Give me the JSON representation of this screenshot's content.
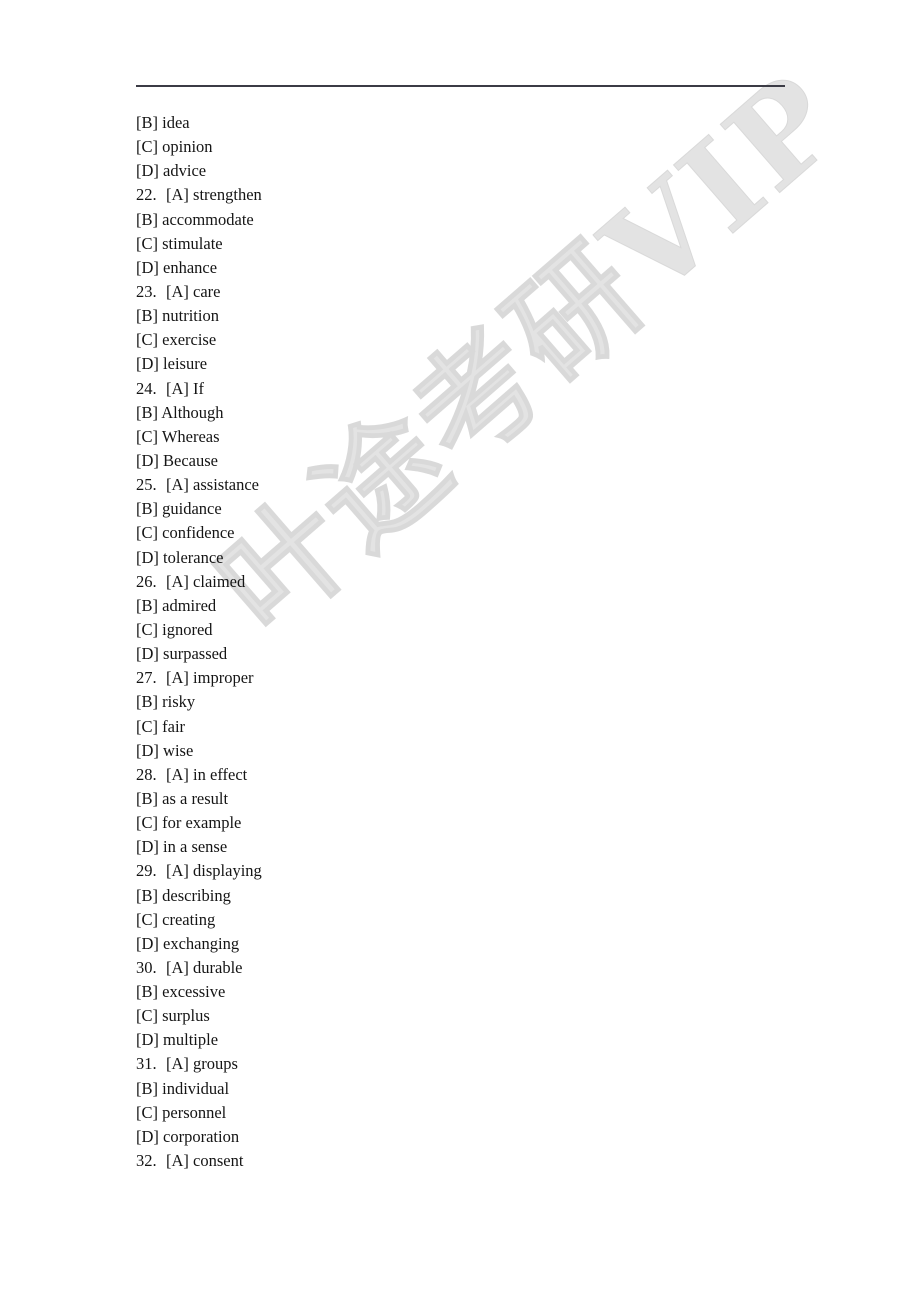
{
  "page": {
    "background_color": "#ffffff",
    "text_color": "#151515",
    "rule_color": "#3b3b45"
  },
  "watermark": {
    "text": "叶途考研VIP",
    "color": "#e2e2e2",
    "rotation_deg": -41
  },
  "header": {
    "rule": "horizontal-rule"
  },
  "lines": [
    {
      "num": "",
      "text": "[B] idea"
    },
    {
      "num": "",
      "text": "[C] opinion"
    },
    {
      "num": "",
      "text": "[D] advice"
    },
    {
      "num": "22.",
      "text": "[A] strengthen"
    },
    {
      "num": "",
      "text": "[B] accommodate"
    },
    {
      "num": "",
      "text": "[C] stimulate"
    },
    {
      "num": "",
      "text": "[D] enhance"
    },
    {
      "num": "23.",
      "text": "[A] care"
    },
    {
      "num": "",
      "text": "[B] nutrition"
    },
    {
      "num": "",
      "text": "[C] exercise"
    },
    {
      "num": "",
      "text": "[D] leisure"
    },
    {
      "num": "24.",
      "text": "[A] If"
    },
    {
      "num": "",
      "text": "[B] Although"
    },
    {
      "num": "",
      "text": "[C] Whereas"
    },
    {
      "num": "",
      "text": "[D] Because"
    },
    {
      "num": "25.",
      "text": "[A] assistance"
    },
    {
      "num": "",
      "text": "[B] guidance"
    },
    {
      "num": "",
      "text": "[C] confidence"
    },
    {
      "num": "",
      "text": "[D] tolerance"
    },
    {
      "num": "26.",
      "text": "[A] claimed"
    },
    {
      "num": "",
      "text": "[B] admired"
    },
    {
      "num": "",
      "text": "[C] ignored"
    },
    {
      "num": "",
      "text": "[D] surpassed"
    },
    {
      "num": "27.",
      "text": "[A] improper"
    },
    {
      "num": "",
      "text": "[B] risky"
    },
    {
      "num": "",
      "text": "[C] fair"
    },
    {
      "num": "",
      "text": "[D] wise"
    },
    {
      "num": "28.",
      "text": "[A] in effect"
    },
    {
      "num": "",
      "text": "[B] as a result"
    },
    {
      "num": "",
      "text": "[C] for example"
    },
    {
      "num": "",
      "text": "[D] in a sense"
    },
    {
      "num": "29.",
      "text": "[A] displaying"
    },
    {
      "num": "",
      "text": "[B] describing"
    },
    {
      "num": "",
      "text": "[C] creating"
    },
    {
      "num": "",
      "text": "[D] exchanging"
    },
    {
      "num": "30.",
      "text": "[A] durable"
    },
    {
      "num": "",
      "text": "[B] excessive"
    },
    {
      "num": "",
      "text": "[C] surplus"
    },
    {
      "num": "",
      "text": "[D] multiple"
    },
    {
      "num": "31.",
      "text": "[A] groups"
    },
    {
      "num": "",
      "text": "[B] individual"
    },
    {
      "num": "",
      "text": "[C] personnel"
    },
    {
      "num": "",
      "text": "[D] corporation"
    },
    {
      "num": "32.",
      "text": "[A] consent"
    }
  ]
}
